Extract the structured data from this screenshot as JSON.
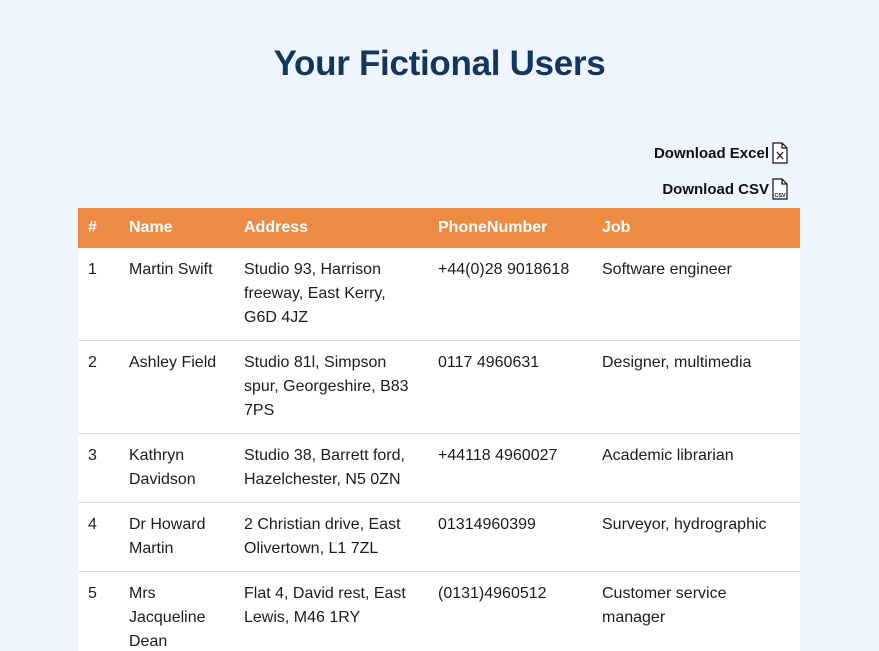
{
  "page": {
    "title": "Your Fictional Users"
  },
  "downloads": {
    "excel": {
      "label": "Download Excel",
      "icon": "excel-file-icon"
    },
    "csv": {
      "label": "Download CSV",
      "icon": "csv-file-icon",
      "icon_text": "CSV"
    }
  },
  "table": {
    "header_color": "#ec8c42",
    "columns": [
      "#",
      "Name",
      "Address",
      "PhoneNumber",
      "Job"
    ],
    "rows": [
      {
        "num": "1",
        "name": "Martin Swift",
        "address": "Studio 93, Harrison freeway, East Kerry, G6D 4JZ",
        "phone": "+44(0)28 9018618",
        "job": "Software engineer"
      },
      {
        "num": "2",
        "name": "Ashley Field",
        "address": "Studio 81l, Simpson spur, Georgeshire, B83 7PS",
        "phone": "0117 4960631",
        "job": "Designer, multimedia"
      },
      {
        "num": "3",
        "name": "Kathryn Davidson",
        "address": "Studio 38, Barrett ford, Hazelchester, N5 0ZN",
        "phone": "+44118 4960027",
        "job": "Academic librarian"
      },
      {
        "num": "4",
        "name": "Dr Howard Martin",
        "address": "2 Christian drive, East Olivertown, L1 7ZL",
        "phone": "01314960399",
        "job": "Surveyor, hydrographic"
      },
      {
        "num": "5",
        "name": "Mrs Jacqueline Dean",
        "address": "Flat 4, David rest, East Lewis, M46 1RY",
        "phone": "(0131)4960512",
        "job": "Customer service manager"
      }
    ]
  }
}
